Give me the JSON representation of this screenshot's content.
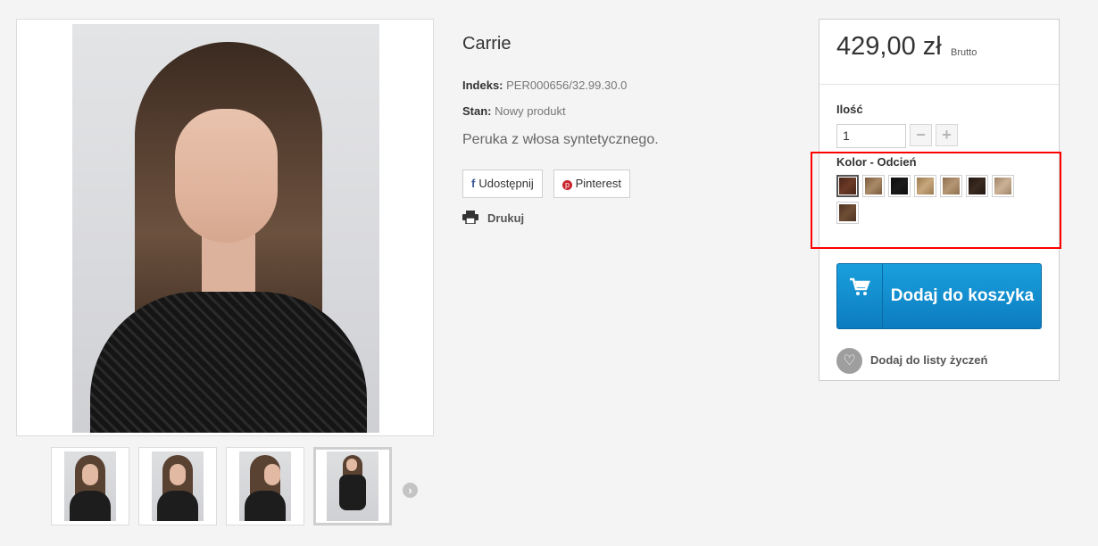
{
  "product": {
    "title": "Carrie",
    "index_label": "Indeks:",
    "index_value": "PER000656/32.99.30.0",
    "state_label": "Stan:",
    "state_value": "Nowy produkt",
    "description": "Peruka z włosa syntetycznego."
  },
  "share": {
    "facebook_label": "Udostępnij",
    "pinterest_label": "Pinterest",
    "facebook_icon": "f",
    "pinterest_icon": "p"
  },
  "print": {
    "label": "Drukuj",
    "icon": "printer-icon"
  },
  "gallery": {
    "main_alt": "product-photo",
    "thumbnails": [
      "thumb-1",
      "thumb-2",
      "thumb-3",
      "thumb-4"
    ],
    "active_thumbnail": 4,
    "next_icon": "›"
  },
  "buy": {
    "price": "429,00 zł",
    "price_note": "Brutto",
    "qty_label": "Ilość",
    "qty_value": "1",
    "minus": "−",
    "plus": "+",
    "color_label": "Kolor - Odcień",
    "swatches": [
      {
        "name": "swatch-1",
        "colors": [
          "#4a2518",
          "#6b3a26"
        ],
        "selected": true
      },
      {
        "name": "swatch-2",
        "colors": [
          "#7a5b3f",
          "#a98a68"
        ]
      },
      {
        "name": "swatch-3",
        "colors": [
          "#0e0e0e",
          "#1a1a1a"
        ]
      },
      {
        "name": "swatch-4",
        "colors": [
          "#9c7a52",
          "#c7a77c"
        ]
      },
      {
        "name": "swatch-5",
        "colors": [
          "#8d6f50",
          "#b59674"
        ]
      },
      {
        "name": "swatch-6",
        "colors": [
          "#231812",
          "#3a2a20"
        ]
      },
      {
        "name": "swatch-7",
        "colors": [
          "#a0846a",
          "#cbb296"
        ]
      },
      {
        "name": "swatch-8",
        "colors": [
          "#4e3322",
          "#6f4d35"
        ]
      }
    ],
    "add_to_cart": "Dodaj do koszyka",
    "wishlist": "Dodaj do listy życzeń",
    "cart_icon": "🛒",
    "heart_icon": "♡"
  },
  "colors": {
    "accent": "#0c7cbf",
    "highlight": "#ff0000"
  }
}
